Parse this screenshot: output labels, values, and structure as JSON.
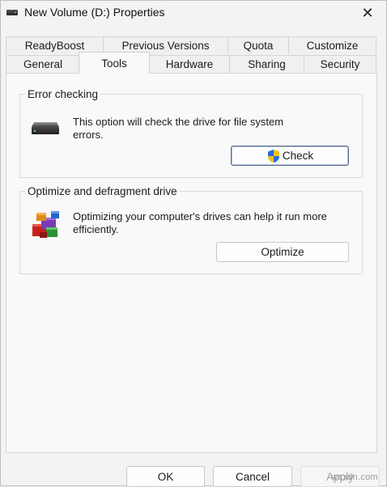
{
  "window": {
    "title": "New Volume (D:) Properties",
    "close_glyph": "✕"
  },
  "tabs": {
    "row1": [
      "ReadyBoost",
      "Previous Versions",
      "Quota",
      "Customize"
    ],
    "row2": [
      "General",
      "Tools",
      "Hardware",
      "Sharing",
      "Security"
    ],
    "active": "Tools"
  },
  "error_checking": {
    "title": "Error checking",
    "description_line1": "This option will check the drive for file system",
    "description_line2": "errors.",
    "button_label": "Check",
    "button_icon": "uac-shield-icon"
  },
  "optimize": {
    "title": "Optimize and defragment drive",
    "description_line1": "Optimizing your computer's drives can help it run more",
    "description_line2": "efficiently.",
    "button_label": "Optimize"
  },
  "footer": {
    "ok_label": "OK",
    "cancel_label": "Cancel",
    "apply_label": "Apply"
  },
  "watermark": "wsxdn.com",
  "colors": {
    "default_button_border": "#5a6e8f",
    "panel_background": "#f9f9f9",
    "window_background": "#f3f3f3"
  }
}
